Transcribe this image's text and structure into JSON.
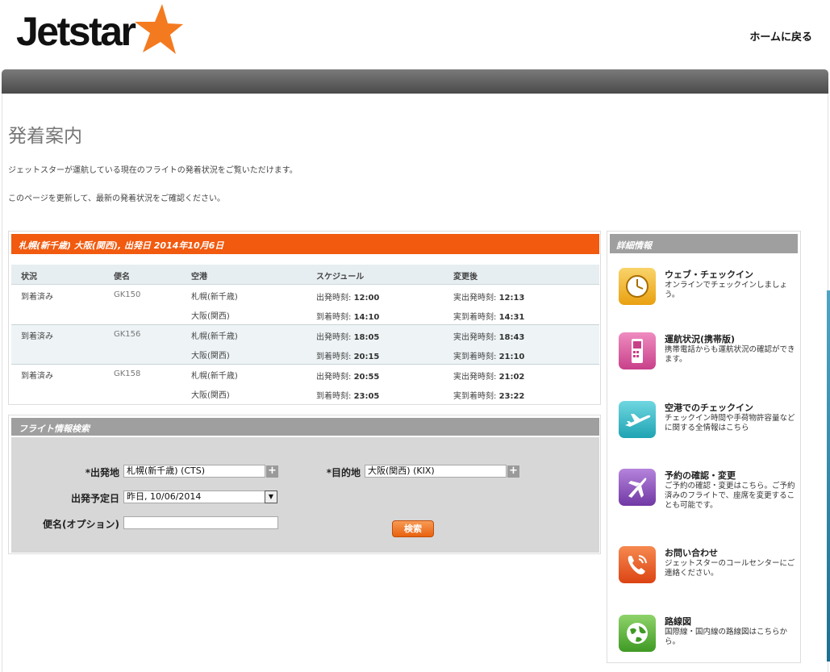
{
  "header": {
    "logo_text": "Jetstar",
    "home_link": "ホームに戻る"
  },
  "page": {
    "title": "発着案内",
    "intro_1": "ジェットスターが運航している現在のフライトの発着状況をご覧いただけます。",
    "intro_2": "このページを更新して、最新の発着状況をご確認ください。"
  },
  "results": {
    "heading": "札幌(新千歳) 大阪(関西), 出発日 2014年10月6日",
    "columns": [
      "状況",
      "便名",
      "空港",
      "スケジュール",
      "変更後"
    ],
    "rows": [
      {
        "status": "到着済み",
        "flight": "GK150",
        "dep_airport": "札幌(新千歳)",
        "arr_airport": "大阪(関西)",
        "sched_dep_label": "出発時刻: ",
        "sched_dep_time": "12:00",
        "sched_arr_label": "到着時刻: ",
        "sched_arr_time": "14:10",
        "act_dep_label": "実出発時刻: ",
        "act_dep_time": "12:13",
        "act_arr_label": "実到着時刻: ",
        "act_arr_time": "14:31"
      },
      {
        "status": "到着済み",
        "flight": "GK156",
        "dep_airport": "札幌(新千歳)",
        "arr_airport": "大阪(関西)",
        "sched_dep_label": "出発時刻: ",
        "sched_dep_time": "18:05",
        "sched_arr_label": "到着時刻: ",
        "sched_arr_time": "20:15",
        "act_dep_label": "実出発時刻: ",
        "act_dep_time": "18:43",
        "act_arr_label": "実到着時刻: ",
        "act_arr_time": "21:10"
      },
      {
        "status": "到着済み",
        "flight": "GK158",
        "dep_airport": "札幌(新千歳)",
        "arr_airport": "大阪(関西)",
        "sched_dep_label": "出発時刻: ",
        "sched_dep_time": "20:55",
        "sched_arr_label": "到着時刻: ",
        "sched_arr_time": "23:05",
        "act_dep_label": "実出発時刻: ",
        "act_dep_time": "21:02",
        "act_arr_label": "実到着時刻: ",
        "act_arr_time": "23:22"
      }
    ]
  },
  "search": {
    "heading": "フライト情報検索",
    "origin_label": "*出発地",
    "origin_value": "札幌(新千歳) (CTS)",
    "destination_label": "*目的地",
    "destination_value": "大阪(関西) (KIX)",
    "date_label": "出発予定日",
    "date_value": "昨日, 10/06/2014",
    "flight_label": "便名(オプション)",
    "flight_value": "",
    "search_button": "検索",
    "plus_glyph": "+"
  },
  "sidebar": {
    "heading": "詳細情報",
    "items": [
      {
        "title": "ウェブ・チェックイン",
        "desc": "オンラインでチェックインしましょう。",
        "icon": "clock-icon",
        "color": "#f3b51c"
      },
      {
        "title": "運航状況(携帯版)",
        "desc": "携帯電話からも運航状況の確認ができます。",
        "icon": "mobile-phone-icon",
        "color": "#d65a9e"
      },
      {
        "title": "空港でのチェックイン",
        "desc": "チェックイン時間や手荷物許容量などに関する全情報はこちら",
        "icon": "airplane-icon",
        "color": "#33b9c8"
      },
      {
        "title": "予約の確認・変更",
        "desc": "ご予約の確認・変更はこちら。ご予約済みのフライトで、座席を変更することも可能です。",
        "icon": "airplane-booking-icon",
        "color": "#8b52b7"
      },
      {
        "title": "お問い合わせ",
        "desc": "ジェットスターのコールセンターにご連絡ください。",
        "icon": "phone-icon",
        "color": "#ee5b21"
      },
      {
        "title": "路線図",
        "desc": "国際線・国内線の路線図はこちらから。",
        "icon": "globe-icon",
        "color": "#62b33d"
      }
    ]
  },
  "colors": {
    "brand_orange": "#f15a0f",
    "header_gray": "#9f9f9f"
  }
}
